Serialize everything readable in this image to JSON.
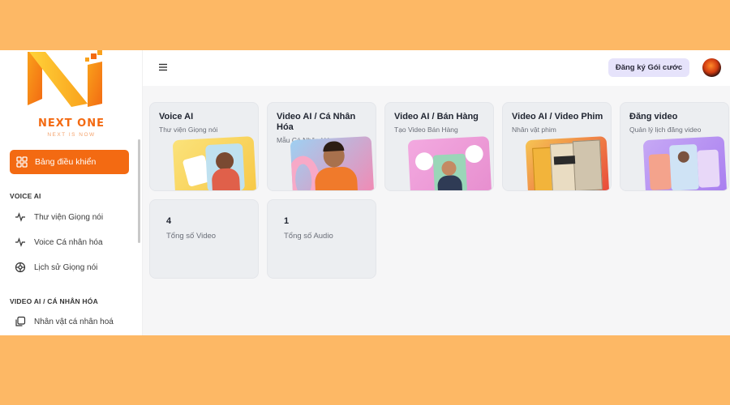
{
  "brand": {
    "name": "NEXT ONE",
    "tagline": "NEXT IS NOW"
  },
  "sidebar": {
    "dashboard_label": "Bảng điều khiển",
    "sections": [
      {
        "label": "VOICE AI",
        "items": [
          {
            "label": "Thư viện Giọng nói",
            "icon": "waveform-icon"
          },
          {
            "label": "Voice Cá nhân hóa",
            "icon": "waveform-icon"
          },
          {
            "label": "Lịch sử Giọng nói",
            "icon": "history-icon"
          }
        ]
      },
      {
        "label": "VIDEO AI / CÁ NHÂN HÓA",
        "items": [
          {
            "label": "Nhân vật cá nhân hoá",
            "icon": "copy-icon"
          }
        ]
      }
    ]
  },
  "header": {
    "subscribe_label": "Đăng ký Gói cước"
  },
  "cards": [
    {
      "title": "Voice AI",
      "subtitle": "Thư viện Giọng nói"
    },
    {
      "title": "Video AI / Cá Nhân Hóa",
      "subtitle": "Mẫu Cá Nhân Hóa"
    },
    {
      "title": "Video AI / Bán Hàng",
      "subtitle": "Tạo Video Bán Hàng"
    },
    {
      "title": "Video AI / Video Phim",
      "subtitle": "Nhân vật phim"
    },
    {
      "title": "Đăng video",
      "subtitle": "Quản lý lịch đăng video"
    }
  ],
  "stats": [
    {
      "value": "4",
      "label": "Tổng số Video"
    },
    {
      "value": "1",
      "label": "Tổng số Audio"
    }
  ],
  "colors": {
    "accent": "#f36a12",
    "background": "#fdb865",
    "subscribe_bg": "#e6e3fb"
  }
}
